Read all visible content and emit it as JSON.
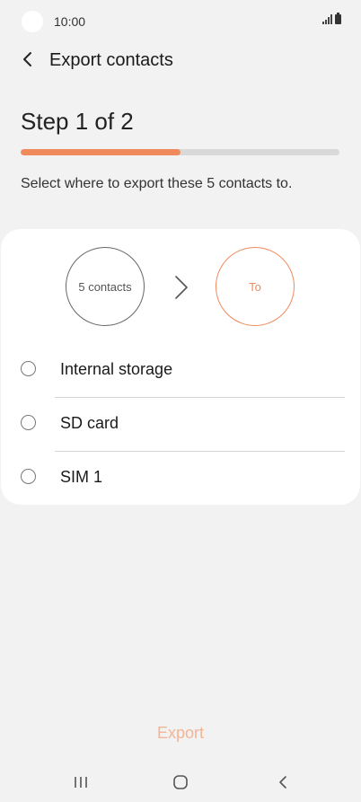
{
  "status_bar": {
    "time": "10:00"
  },
  "app_bar": {
    "title": "Export contacts",
    "back_icon": "chevron-left-icon"
  },
  "step": {
    "title": "Step 1 of 2",
    "progress": 0.5
  },
  "instruction": "Select where to export these 5 contacts to.",
  "flow": {
    "from_label": "5 contacts",
    "to_label": "To"
  },
  "options": [
    {
      "label": "Internal storage",
      "selected": false
    },
    {
      "label": "SD card",
      "selected": false
    },
    {
      "label": "SIM 1",
      "selected": false
    }
  ],
  "footer": {
    "export_label": "Export"
  },
  "colors": {
    "accent": "#ef8a5c",
    "background": "#f2f2f2",
    "card": "#ffffff",
    "disabled_button": "#f2b496"
  },
  "nav_bar": {
    "items": [
      "recent-apps-icon",
      "home-icon",
      "back-icon"
    ]
  }
}
